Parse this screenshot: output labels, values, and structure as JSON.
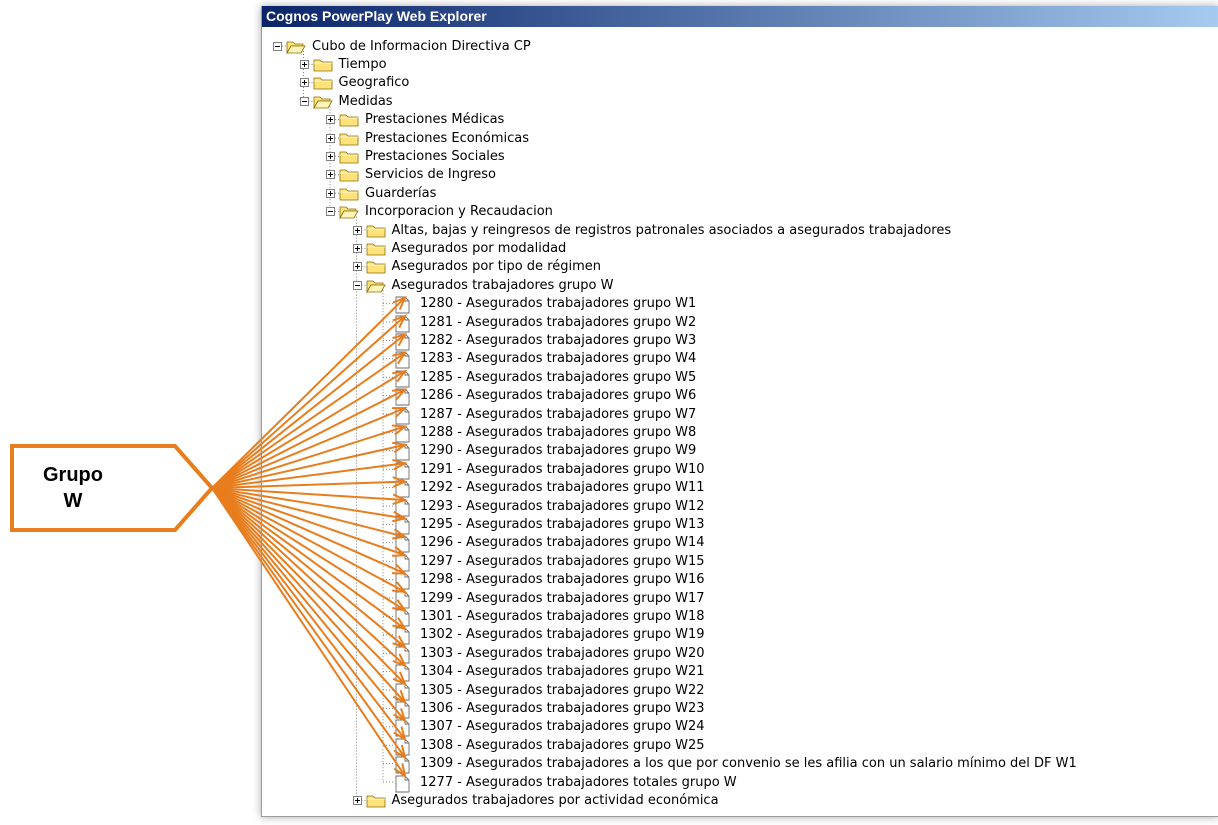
{
  "window": {
    "title": "Cognos PowerPlay Web Explorer"
  },
  "tree": [
    {
      "label": "Cubo de Informacion Directiva CP",
      "level": 0,
      "state": "expanded",
      "icon": "folder-open-icon"
    },
    {
      "label": "Tiempo",
      "level": 1,
      "state": "collapsed",
      "icon": "folder-icon"
    },
    {
      "label": "Geografico",
      "level": 1,
      "state": "collapsed",
      "icon": "folder-icon"
    },
    {
      "label": "Medidas",
      "level": 1,
      "state": "expanded",
      "icon": "folder-open-icon"
    },
    {
      "label": "Prestaciones Médicas",
      "level": 2,
      "state": "collapsed",
      "icon": "folder-icon"
    },
    {
      "label": "Prestaciones Económicas",
      "level": 2,
      "state": "collapsed",
      "icon": "folder-icon"
    },
    {
      "label": "Prestaciones Sociales",
      "level": 2,
      "state": "collapsed",
      "icon": "folder-icon"
    },
    {
      "label": "Servicios de Ingreso",
      "level": 2,
      "state": "collapsed",
      "icon": "folder-icon"
    },
    {
      "label": "Guarderías",
      "level": 2,
      "state": "collapsed",
      "icon": "folder-icon"
    },
    {
      "label": "Incorporacion y Recaudacion",
      "level": 2,
      "state": "expanded",
      "icon": "folder-open-icon"
    },
    {
      "label": "Altas, bajas y reingresos de registros patronales asociados a asegurados trabajadores",
      "level": 3,
      "state": "collapsed",
      "icon": "folder-icon"
    },
    {
      "label": "Asegurados por modalidad",
      "level": 3,
      "state": "collapsed",
      "icon": "folder-icon"
    },
    {
      "label": "Asegurados por tipo de régimen",
      "level": 3,
      "state": "collapsed",
      "icon": "folder-icon"
    },
    {
      "label": "Asegurados  trabajadores grupo W",
      "level": 3,
      "state": "expanded",
      "icon": "folder-open-icon"
    },
    {
      "label": "1280 - Asegurados trabajadores grupo W1",
      "level": 4,
      "state": "leaf",
      "icon": "document-icon"
    },
    {
      "label": "1281 - Asegurados trabajadores grupo W2",
      "level": 4,
      "state": "leaf",
      "icon": "document-icon"
    },
    {
      "label": "1282 - Asegurados trabajadores grupo W3",
      "level": 4,
      "state": "leaf",
      "icon": "document-icon"
    },
    {
      "label": "1283 - Asegurados trabajadores grupo W4",
      "level": 4,
      "state": "leaf",
      "icon": "document-icon"
    },
    {
      "label": "1285 - Asegurados trabajadores grupo W5",
      "level": 4,
      "state": "leaf",
      "icon": "document-icon"
    },
    {
      "label": "1286 - Asegurados trabajadores grupo W6",
      "level": 4,
      "state": "leaf",
      "icon": "document-icon"
    },
    {
      "label": "1287 - Asegurados trabajadores grupo W7",
      "level": 4,
      "state": "leaf",
      "icon": "document-icon"
    },
    {
      "label": "1288 - Asegurados trabajadores grupo W8",
      "level": 4,
      "state": "leaf",
      "icon": "document-icon"
    },
    {
      "label": "1290 - Asegurados trabajadores grupo W9",
      "level": 4,
      "state": "leaf",
      "icon": "document-icon"
    },
    {
      "label": "1291 - Asegurados trabajadores grupo W10",
      "level": 4,
      "state": "leaf",
      "icon": "document-icon"
    },
    {
      "label": "1292 - Asegurados trabajadores grupo W11",
      "level": 4,
      "state": "leaf",
      "icon": "document-icon"
    },
    {
      "label": "1293 - Asegurados trabajadores grupo W12",
      "level": 4,
      "state": "leaf",
      "icon": "document-icon"
    },
    {
      "label": "1295 - Asegurados trabajadores grupo W13",
      "level": 4,
      "state": "leaf",
      "icon": "document-icon"
    },
    {
      "label": "1296 - Asegurados trabajadores grupo W14",
      "level": 4,
      "state": "leaf",
      "icon": "document-icon"
    },
    {
      "label": "1297 - Asegurados trabajadores grupo W15",
      "level": 4,
      "state": "leaf",
      "icon": "document-icon"
    },
    {
      "label": "1298 - Asegurados trabajadores grupo W16",
      "level": 4,
      "state": "leaf",
      "icon": "document-icon"
    },
    {
      "label": "1299 - Asegurados trabajadores grupo W17",
      "level": 4,
      "state": "leaf",
      "icon": "document-icon"
    },
    {
      "label": "1301 - Asegurados trabajadores grupo W18",
      "level": 4,
      "state": "leaf",
      "icon": "document-icon"
    },
    {
      "label": "1302 - Asegurados trabajadores grupo W19",
      "level": 4,
      "state": "leaf",
      "icon": "document-icon"
    },
    {
      "label": "1303 - Asegurados trabajadores grupo W20",
      "level": 4,
      "state": "leaf",
      "icon": "document-icon"
    },
    {
      "label": "1304 - Asegurados trabajadores grupo W21",
      "level": 4,
      "state": "leaf",
      "icon": "document-icon"
    },
    {
      "label": "1305 - Asegurados trabajadores grupo W22",
      "level": 4,
      "state": "leaf",
      "icon": "document-icon"
    },
    {
      "label": "1306 - Asegurados trabajadores grupo W23",
      "level": 4,
      "state": "leaf",
      "icon": "document-icon"
    },
    {
      "label": "1307 - Asegurados trabajadores grupo W24",
      "level": 4,
      "state": "leaf",
      "icon": "document-icon"
    },
    {
      "label": "1308 - Asegurados trabajadores grupo W25",
      "level": 4,
      "state": "leaf",
      "icon": "document-icon"
    },
    {
      "label": "1309 - Asegurados trabajadores a los que por convenio se les afilia con un salario mínimo del DF W1",
      "level": 4,
      "state": "leaf",
      "icon": "document-icon"
    },
    {
      "label": "1277 - Asegurados trabajadores totales grupo W",
      "level": 4,
      "state": "leaf",
      "icon": "document-icon"
    },
    {
      "label": "Asegurados  trabajadores por actividad económica",
      "level": 3,
      "state": "collapsed",
      "icon": "folder-icon"
    }
  ],
  "callout": {
    "line1": "Grupo",
    "line2": "W",
    "color": "#e87d1e"
  },
  "colors": {
    "title_bar_start": "#0a246a",
    "title_bar_end": "#a6caf0",
    "folder": "#ffe27a",
    "tree_lines": "#808080"
  }
}
